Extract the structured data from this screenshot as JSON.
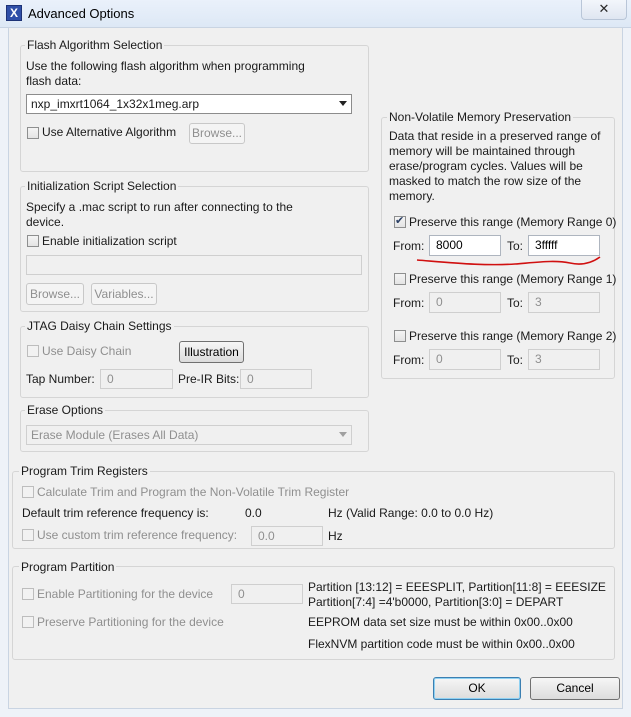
{
  "window": {
    "title": "Advanced Options",
    "close_label": "✕"
  },
  "flash": {
    "legend": "Flash Algorithm Selection",
    "description": "Use the following flash algorithm when programming flash data:",
    "algorithm_selected": "nxp_imxrt1064_1x32x1meg.arp",
    "use_alt_label": "Use Alternative Algorithm",
    "browse_label": "Browse..."
  },
  "init": {
    "legend": "Initialization Script Selection",
    "description": "Specify a .mac script to run after connecting to the device.",
    "enable_label": "Enable initialization script",
    "script_path": "",
    "browse_label": "Browse...",
    "variables_label": "Variables..."
  },
  "jtag": {
    "legend": "JTAG Daisy Chain Settings",
    "use_daisy_label": "Use Daisy Chain",
    "illustration_label": "Illustration",
    "tap_label": "Tap Number:",
    "tap_value": "0",
    "preir_label": "Pre-IR Bits:",
    "preir_value": "0"
  },
  "erase": {
    "legend": "Erase Options",
    "selected": "Erase Module (Erases All Data)"
  },
  "nvm": {
    "legend": "Non-Volatile Memory Preservation",
    "description": "Data that reside in a preserved range of memory will be maintained through erase/program cycles. Values will be masked to match the row size of the memory.",
    "from_label": "From:",
    "to_label": "To:",
    "ranges": [
      {
        "label": "Preserve this range (Memory Range 0)",
        "checked": true,
        "from": "8000",
        "to": "3fffff"
      },
      {
        "label": "Preserve this range (Memory Range 1)",
        "checked": false,
        "from": "0",
        "to": "3"
      },
      {
        "label": "Preserve this range (Memory Range 2)",
        "checked": false,
        "from": "0",
        "to": "3"
      }
    ],
    "annotation_color": "#d01010"
  },
  "trim": {
    "legend": "Program Trim Registers",
    "calc_label": "Calculate Trim and Program the Non-Volatile Trim Register",
    "default_freq_label": "Default trim reference frequency is:",
    "default_freq_value": "0.0",
    "hz_range": "Hz (Valid Range: 0.0 to 0.0 Hz)",
    "custom_label": "Use custom trim reference frequency:",
    "custom_value": "0.0",
    "hz": "Hz"
  },
  "partition": {
    "legend": "Program Partition",
    "enable_label": "Enable Partitioning for the device",
    "enable_value": "0",
    "preserve_label": "Preserve Partitioning for the device",
    "info_line1": "Partition [13:12] = EEESPLIT, Partition[11:8] = EEESIZE",
    "info_line2": "Partition[7:4] =4'b0000, Partition[3:0] = DEPART",
    "eeprom_note": "EEPROM data set size must be within 0x00..0x00",
    "flexnvm_note": "FlexNVM partition code must be within 0x00..0x00"
  },
  "footer": {
    "ok_label": "OK",
    "cancel_label": "Cancel"
  }
}
